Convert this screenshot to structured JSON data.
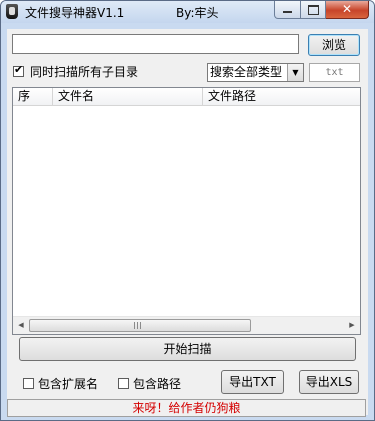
{
  "window": {
    "title": "文件搜导神器V1.1",
    "author": "By:牢头",
    "controls": {
      "minimize": "minimize",
      "maximize": "maximize",
      "close": "✕"
    }
  },
  "search": {
    "path_value": "",
    "browse_label": "浏览"
  },
  "options": {
    "scan_subdirs_label": "同时扫描所有子目录",
    "scan_subdirs_checked": true,
    "type_select_value": "搜索全部类型",
    "ext_placeholder": "txt"
  },
  "table": {
    "columns": [
      "序",
      "文件名",
      "文件路径"
    ],
    "rows": [],
    "scroll_grip": "III"
  },
  "actions": {
    "start_label": "开始扫描",
    "include_ext_label": "包含扩展名",
    "include_ext_checked": false,
    "include_path_label": "包含路径",
    "include_path_checked": false,
    "export_txt_label": "导出TXT",
    "export_xls_label": "导出XLS"
  },
  "status": {
    "message": "来呀！给作者仍狗粮",
    "color": "#d40000"
  }
}
